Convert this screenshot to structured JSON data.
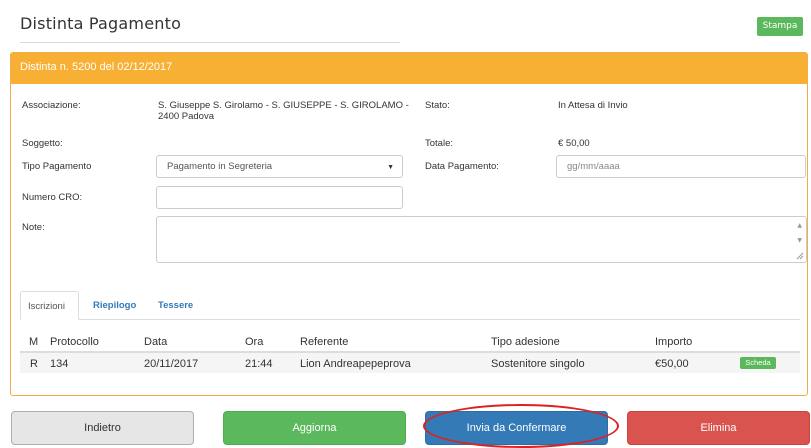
{
  "header": {
    "title": "Distinta Pagamento",
    "print_label": "Stampa"
  },
  "panel": {
    "heading": "Distinta n. 5200 del 02/12/2017"
  },
  "fields": {
    "associazione_label": "Associazione:",
    "associazione_value_line1": "S. Giuseppe S. Girolamo - S. GIUSEPPE - S. GIROLAMO -",
    "associazione_value_line2": "2400 Padova",
    "stato_label": "Stato:",
    "stato_value": "In Attesa di Invio",
    "soggetto_label": "Soggetto:",
    "totale_label": "Totale:",
    "totale_value": "€ 50,00",
    "tipo_pagamento_label": "Tipo Pagamento",
    "tipo_pagamento_selected": "Pagamento in Segreteria",
    "data_pagamento_label": "Data Pagamento:",
    "data_pagamento_placeholder": "gg/mm/aaaa",
    "numero_cro_label": "Numero CRO:",
    "numero_cro_value": "",
    "note_label": "Note:"
  },
  "tabs": [
    {
      "label": "Iscrizioni",
      "active": true
    },
    {
      "label": "Riepilogo",
      "active": false
    },
    {
      "label": "Tessere",
      "active": false
    }
  ],
  "table": {
    "headers": [
      "M",
      "Protocollo",
      "Data",
      "Ora",
      "Referente",
      "Tipo adesione",
      "Importo"
    ],
    "rows": [
      {
        "m": "R",
        "protocollo": "134",
        "data": "20/11/2017",
        "ora": "21:44",
        "referente": "Lion Andreapepeprova",
        "tipo": "Sostenitore singolo",
        "importo": "€50,00",
        "action": "Scheda"
      }
    ]
  },
  "actions": {
    "back": "Indietro",
    "update": "Aggiorna",
    "send": "Invia da Confermare",
    "delete": "Elimina"
  },
  "colors": {
    "panel_header": "#f7b033",
    "success": "#5cb85c",
    "primary": "#337ab7",
    "danger": "#d9534f",
    "highlight_ellipse": "#e02020"
  },
  "icons": {
    "select_caret": "▼",
    "spin_up": "▲",
    "spin_down": "▼"
  }
}
